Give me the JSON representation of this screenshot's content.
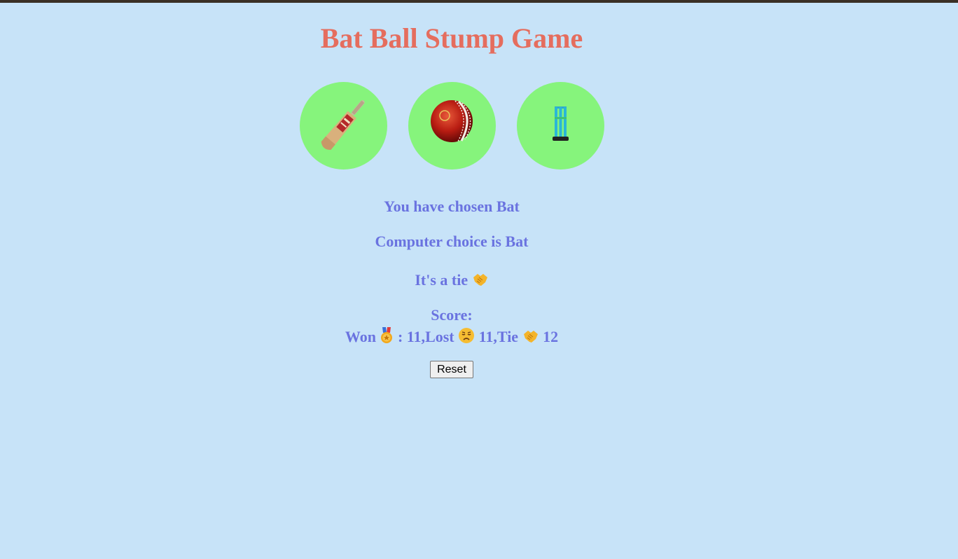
{
  "title": "Bat Ball Stump Game",
  "choices": [
    {
      "name": "Bat",
      "icon": "cricket-bat-icon"
    },
    {
      "name": "Ball",
      "icon": "cricket-ball-icon"
    },
    {
      "name": "Stump",
      "icon": "cricket-stumps-icon"
    }
  ],
  "result": {
    "user_choice": "You have chosen Bat",
    "computer_choice": "Computer choice is Bat",
    "outcome": "It's a tie"
  },
  "score": {
    "heading": "Score:",
    "won_label": "Won",
    "won_sep": ": 11,",
    "lost_label": "Lost",
    "lost_value": "11,",
    "tie_label": "Tie",
    "tie_value": "12"
  },
  "reset_label": "Reset",
  "colors": {
    "background": "#c7e3f8",
    "title": "#e56d5e",
    "text": "#6a73e0",
    "choice_circle": "#86f47c"
  }
}
